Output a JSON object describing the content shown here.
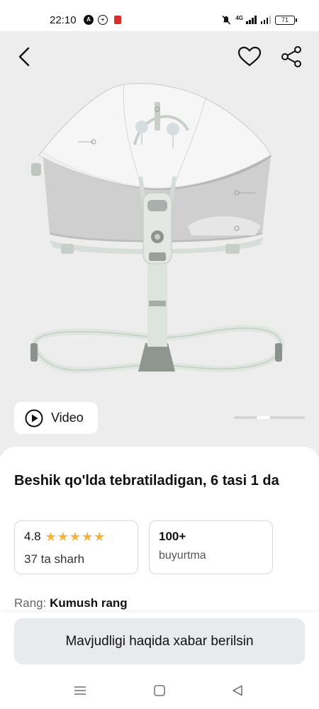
{
  "status_bar": {
    "time": "22:10",
    "network": "4G",
    "battery": "71"
  },
  "product": {
    "title": "Beshik qo'lda tebratiladigan, 6 tasi 1 da",
    "video_label": "Video",
    "rating": "4.8",
    "stars_filled": 5,
    "reviews": "37 ta sharh",
    "orders_value": "100+",
    "orders_label": "buyurtma",
    "color_label": "Rang:",
    "color_value": "Kumush rang"
  },
  "actions": {
    "notify_label": "Mavjudligi haqida xabar berilsin"
  },
  "icons": {
    "back": "back-arrow-icon",
    "favorite": "heart-icon",
    "share": "share-icon",
    "video": "play-icon",
    "star": "star-icon",
    "nav_menu": "menu-icon",
    "nav_home": "home-icon",
    "nav_back": "nav-back-icon"
  },
  "colors": {
    "star": "#f5b335",
    "hero_bg": "#ededed",
    "button_bg": "#e9eaee"
  }
}
